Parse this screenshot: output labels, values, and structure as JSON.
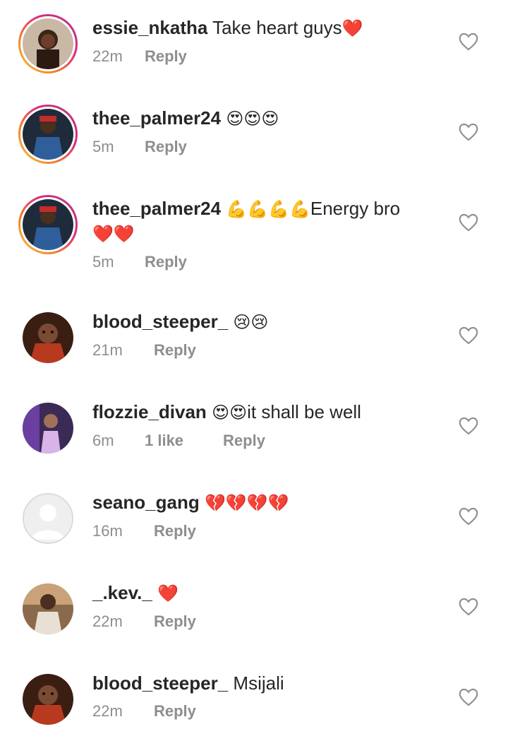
{
  "comments": [
    {
      "username": "essie_nkatha",
      "text": "Take heart guys",
      "emoji": "❤️",
      "time": "22m",
      "likes": "",
      "reply": "Reply"
    },
    {
      "username": "thee_palmer24",
      "text": "",
      "emoji": "😍😍😍",
      "time": "5m",
      "likes": "",
      "reply": "Reply"
    },
    {
      "username": "thee_palmer24",
      "text": "Energy bro",
      "emoji": "💪💪💪💪",
      "emoji2": "❤️❤️",
      "time": "5m",
      "likes": "",
      "reply": "Reply"
    },
    {
      "username": "blood_steeper_",
      "text": "",
      "emoji": "😢😢",
      "time": "21m",
      "likes": "",
      "reply": "Reply"
    },
    {
      "username": "flozzie_divan",
      "text": "it shall be well",
      "emoji": "😍😍",
      "time": "6m",
      "likes": "1 like",
      "reply": "Reply"
    },
    {
      "username": "seano_gang",
      "text": "",
      "emoji": "💔💔💔💔",
      "time": "16m",
      "likes": "",
      "reply": "Reply"
    },
    {
      "username": "_.kev._",
      "text": "",
      "emoji": "❤️",
      "time": "22m",
      "likes": "",
      "reply": "Reply"
    },
    {
      "username": "blood_steeper_",
      "text": "Msijali",
      "emoji": "",
      "time": "22m",
      "likes": "",
      "reply": "Reply"
    }
  ],
  "icons": {
    "like": "heart-outline-icon"
  },
  "colors": {
    "meta": "#8e8e8e",
    "text": "#262626",
    "story_ring_start": "#f58529",
    "story_ring_end": "#dd2a7b"
  }
}
